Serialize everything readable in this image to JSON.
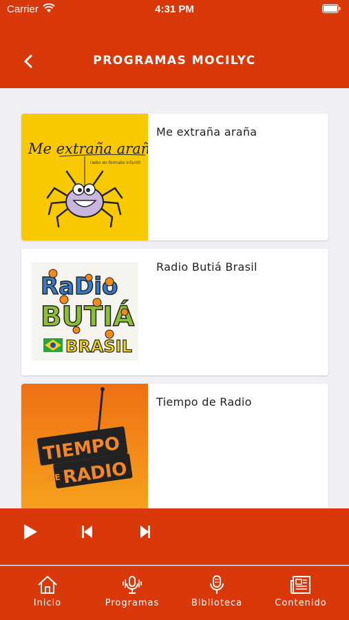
{
  "status_bar": {
    "carrier": "Carrier",
    "time": "4:31 PM"
  },
  "header": {
    "title": "PROGRAMAS MOCILYC"
  },
  "programs": [
    {
      "title": "Me extraña araña",
      "logo_text": "Me extraña araña",
      "logo_subtext": "radio en formato infantil",
      "thumb_color": "#f9c900"
    },
    {
      "title": "Radio Butiá Brasil",
      "logo_lines": [
        "RADIO",
        "BUTIÁ",
        "BRASIL"
      ],
      "thumb_color": "#ffffff"
    },
    {
      "title": "Tiempo de Radio",
      "logo_lines": [
        "TIEMPO",
        "DE",
        "RADIO"
      ],
      "thumb_color": "#f27a12"
    }
  ],
  "tabs": [
    {
      "label": "Inicio",
      "icon": "home-icon"
    },
    {
      "label": "Programas",
      "icon": "podcast-icon"
    },
    {
      "label": "Biblioteca",
      "icon": "microphone-icon"
    },
    {
      "label": "Contenido",
      "icon": "newspaper-icon"
    }
  ],
  "colors": {
    "accent": "#d9380a",
    "background": "#efeff4"
  }
}
